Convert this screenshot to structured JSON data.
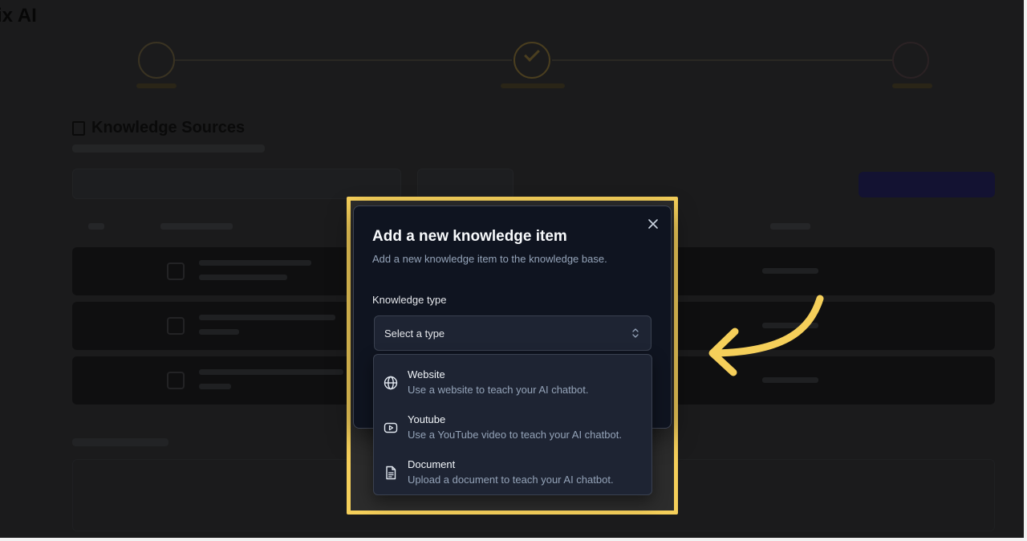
{
  "background": {
    "brand": "ix AI",
    "section_heading": "Knowledge Sources"
  },
  "dialog": {
    "title": "Add a new knowledge item",
    "description": "Add a new knowledge item to the knowledge base.",
    "field_label": "Knowledge type",
    "select_placeholder": "Select a type",
    "close_label": "×"
  },
  "dropdown": {
    "options": [
      {
        "title": "Website",
        "description": "Use a website to teach your AI chatbot.",
        "icon": "globe-icon"
      },
      {
        "title": "Youtube",
        "description": "Use a YouTube video to teach your AI chatbot.",
        "icon": "youtube-icon"
      },
      {
        "title": "Document",
        "description": "Upload a document to teach your AI chatbot.",
        "icon": "document-icon"
      }
    ]
  },
  "colors": {
    "highlight": "#f5cf5a",
    "dialog_bg": "#0f1420",
    "select_bg": "#1e2433",
    "arrow": "#f5cf5a"
  }
}
